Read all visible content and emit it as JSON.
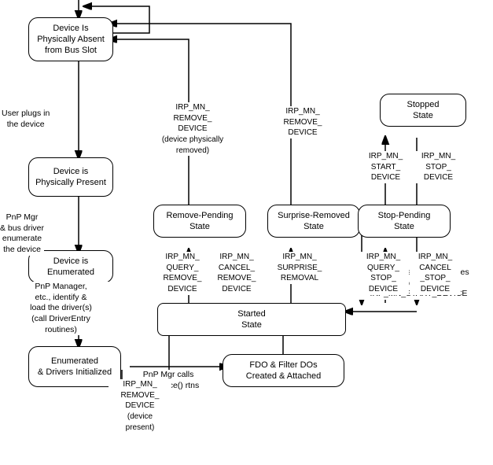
{
  "nodes": {
    "absent": {
      "label": "Device Is\nPhysically Absent\nfrom Bus Slot"
    },
    "present": {
      "label": "Device is\nPhysically Present"
    },
    "enumerated": {
      "label": "Device is\nEnumerated"
    },
    "drivers_init": {
      "label": "Enumerated\n& Drivers Initialized"
    },
    "fdo": {
      "label": "FDO & Filter DOs\nCreated & Attached"
    },
    "started": {
      "label": "Started\nState"
    },
    "remove_pending": {
      "label": "Remove-Pending\nState"
    },
    "surprise_removed": {
      "label": "Surprise-Removed\nState"
    },
    "stop_pending": {
      "label": "Stop-Pending\nState"
    },
    "stopped": {
      "label": "Stopped\nState"
    }
  },
  "labels": {
    "user_plugs": "User plugs in\nthe device",
    "pnp_enumerate": "PnP Mgr\n& bus driver\nenumerate\nthe device",
    "pnp_load": "PnP Manager,\netc., identify &\nload the driver(s)\n(call DriverEntry\nroutines)",
    "pnp_adddevice": "PnP Mgr calls\nAddDevice() rtns",
    "pnp_assigns": "PnP Mgr assigns resources\nand sends\nIRP_MN_START_DEVICE",
    "irp_remove_present": "IRP_MN_\nREMOVE_\nDEVICE\n(device\npresent)",
    "irp_remove_physical": "IRP_MN_\nREMOVE_\nDEVICE\n(device physically\nremoved)",
    "irp_remove_device2": "IRP_MN_\nREMOVE_\nDEVICE",
    "irp_query_remove": "IRP_MN_\nQUERY_\nREMOVE_\nDEVICE",
    "irp_cancel_remove": "IRP_MN_\nCANCEL_\nREMOVE_\nDEVICE",
    "irp_surprise": "IRP_MN_\nSURPRISE_\nREMOVAL",
    "irp_start_device": "IRP_MN_\nSTART_\nDEVICE",
    "irp_stop_device": "IRP_MN_\nSTOP_\nDEVICE",
    "irp_query_stop": "IRP_MN_\nQUERY_\nSTOP_\nDEVICE",
    "irp_cancel_stop": "IRP_MN_\nCANCEL\n_STOP_\nDEVICE"
  }
}
